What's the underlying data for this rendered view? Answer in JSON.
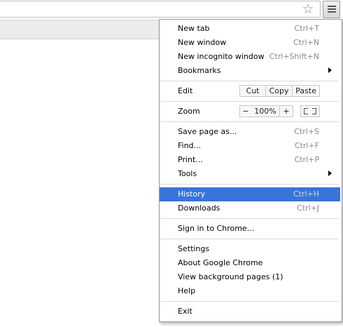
{
  "toolbar": {
    "star_icon": "star-icon",
    "menu_icon": "hamburger-menu-icon"
  },
  "menu": {
    "new_tab": {
      "label": "New tab",
      "shortcut": "Ctrl+T"
    },
    "new_window": {
      "label": "New window",
      "shortcut": "Ctrl+N"
    },
    "new_incognito": {
      "label": "New incognito window",
      "shortcut": "Ctrl+Shift+N"
    },
    "bookmarks": {
      "label": "Bookmarks"
    },
    "edit": {
      "label": "Edit",
      "cut": "Cut",
      "copy": "Copy",
      "paste": "Paste"
    },
    "zoom": {
      "label": "Zoom",
      "minus": "−",
      "value": "100%",
      "plus": "+"
    },
    "save_page": {
      "label": "Save page as...",
      "shortcut": "Ctrl+S"
    },
    "find": {
      "label": "Find...",
      "shortcut": "Ctrl+F"
    },
    "print": {
      "label": "Print...",
      "shortcut": "Ctrl+P"
    },
    "tools": {
      "label": "Tools"
    },
    "history": {
      "label": "History",
      "shortcut": "Ctrl+H"
    },
    "downloads": {
      "label": "Downloads",
      "shortcut": "Ctrl+J"
    },
    "sign_in": {
      "label": "Sign in to Chrome..."
    },
    "settings": {
      "label": "Settings"
    },
    "about": {
      "label": "About Google Chrome"
    },
    "background_pages": {
      "label": "View background pages (1)"
    },
    "help": {
      "label": "Help"
    },
    "exit": {
      "label": "Exit"
    }
  },
  "colors": {
    "highlight": "#3875d7",
    "shortcut_text": "#8a8a8a"
  }
}
